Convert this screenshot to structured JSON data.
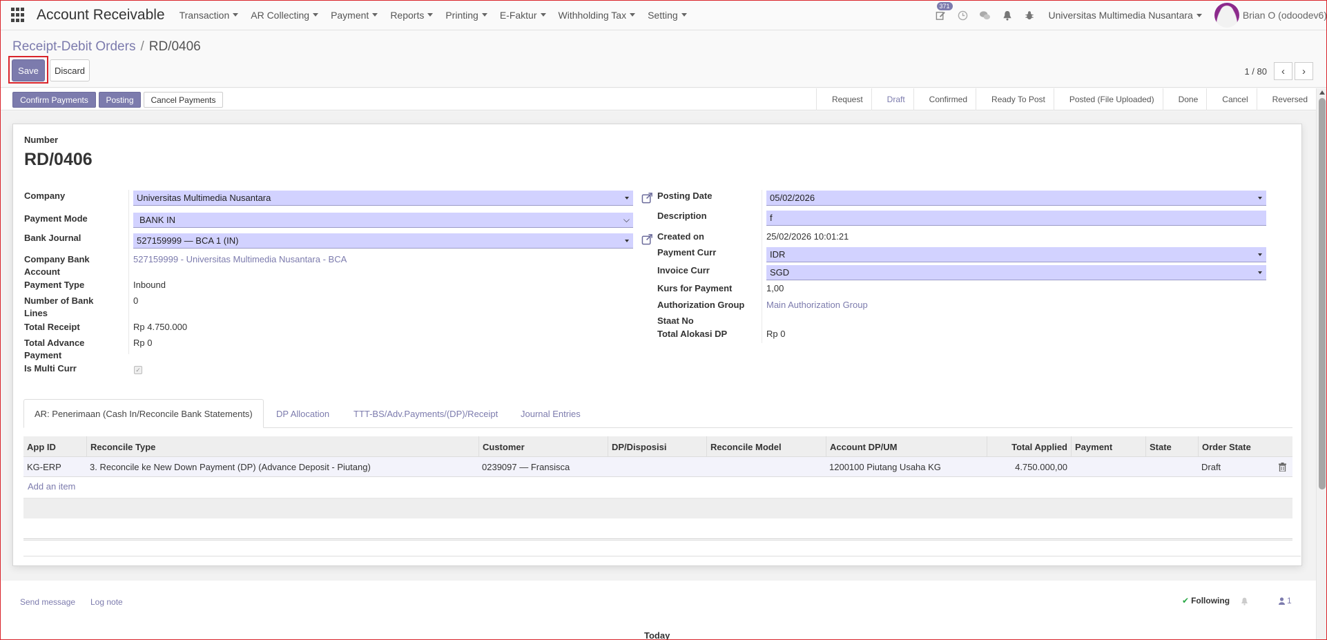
{
  "navbar": {
    "app_title": "Account Receivable",
    "menus": [
      "Transaction",
      "AR Collecting",
      "Payment",
      "Reports",
      "Printing",
      "E-Faktur",
      "Withholding Tax",
      "Setting"
    ],
    "activity_badge": "371",
    "company": "Universitas Multimedia Nusantara",
    "user": "Brian O (odoodev6)"
  },
  "breadcrumb": {
    "parent": "Receipt-Debit Orders",
    "separator": "/",
    "current": "RD/0406"
  },
  "toolbar": {
    "save_label": "Save",
    "discard_label": "Discard"
  },
  "pager": {
    "value": "1 / 80"
  },
  "statusbar": {
    "buttons": [
      "Confirm Payments",
      "Posting",
      "Cancel Payments"
    ],
    "stages": [
      "Request",
      "Draft",
      "Confirmed",
      "Ready To Post",
      "Posted (File Uploaded)",
      "Done",
      "Cancel",
      "Reversed"
    ],
    "active_stage": "Draft"
  },
  "form": {
    "number_label": "Number",
    "number": "RD/0406",
    "left": {
      "company_label": "Company",
      "company": "Universitas Multimedia Nusantara",
      "payment_mode_label": "Payment Mode",
      "payment_mode": "BANK IN",
      "bank_journal_label": "Bank Journal",
      "bank_journal": "527159999 — BCA 1 (IN)",
      "company_bank_account_label_1": "Company Bank",
      "company_bank_account_label_2": "Account",
      "company_bank_account": "527159999 - Universitas Multimedia Nusantara - BCA",
      "payment_type_label": "Payment Type",
      "payment_type": "Inbound",
      "number_bank_lines_label_1": "Number of Bank",
      "number_bank_lines_label_2": "Lines",
      "number_bank_lines": "0",
      "total_receipt_label": "Total Receipt",
      "total_receipt": "Rp 4.750.000",
      "total_advance_label_1": "Total Advance",
      "total_advance_label_2": "Payment",
      "total_advance": "Rp 0",
      "is_multi_curr_label": "Is Multi Curr"
    },
    "right": {
      "posting_date_label": "Posting Date",
      "posting_date": "05/02/2026",
      "description_label": "Description",
      "description": "f",
      "created_on_label": "Created on",
      "created_on": "25/02/2026 10:01:21",
      "payment_curr_label": "Payment Curr",
      "payment_curr": "IDR",
      "invoice_curr_label": "Invoice Curr",
      "invoice_curr": "SGD",
      "kurs_label": "Kurs for Payment",
      "kurs": "1,00",
      "auth_group_label": "Authorization Group",
      "auth_group": "Main Authorization Group",
      "staat_no_label": "Staat No",
      "total_alokasi_label": "Total Alokasi DP",
      "total_alokasi": "Rp 0"
    }
  },
  "tabs": [
    "AR: Penerimaan (Cash In/Reconcile Bank Statements)",
    "DP Allocation",
    "TTT-BS/Adv.Payments/(DP)/Receipt",
    "Journal Entries"
  ],
  "table": {
    "columns": [
      "App ID",
      "Reconcile Type",
      "Customer",
      "DP/Disposisi",
      "Reconcile Model",
      "Account DP/UM",
      "Total Applied",
      "Payment",
      "State",
      "Order State"
    ],
    "rows": [
      [
        "KG-ERP",
        "3. Reconcile ke New Down Payment (DP) (Advance Deposit - Piutang)",
        "0239097 — Fransisca",
        "",
        "",
        "1200100 Piutang Usaha KG",
        "4.750.000,00",
        "",
        "",
        "Draft"
      ]
    ],
    "add_item": "Add an item"
  },
  "chatter": {
    "send_message": "Send message",
    "log_note": "Log note",
    "following": "Following",
    "followers": "1",
    "today": "Today"
  },
  "icons": {
    "apps": "apps-grid-icon",
    "activity": "edit-icon",
    "clock": "clock-icon",
    "chat": "chat-icon",
    "bell": "bell-icon",
    "debug": "bug-icon",
    "external": "external-link-icon",
    "trash": "trash-icon",
    "check": "check-icon",
    "user": "user-icon"
  },
  "colors": {
    "primary": "#7c7bad",
    "required_field": "#d2d2ff",
    "highlight": "#d9232a"
  }
}
